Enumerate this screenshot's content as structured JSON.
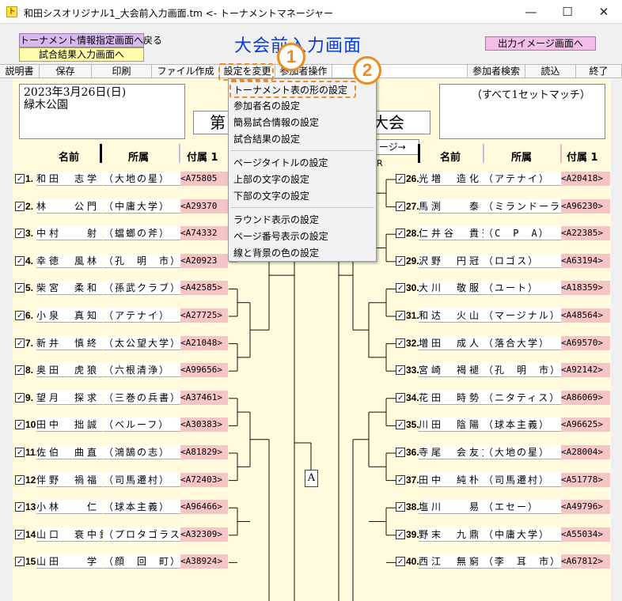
{
  "window": {
    "title": "和田シスオリジナル1_大会前入力画面.tm <- トーナメントマネージャー",
    "icon_glyph": "ト",
    "minimize": "—",
    "maximize": "☐",
    "close": "✕"
  },
  "top_buttons": {
    "back": "トーナメント情報指定画面へ戻る",
    "result": "試合結果入力画面へ",
    "output": "出力イメージ画面へ"
  },
  "page_title": "大会前入力画面",
  "toolbar": {
    "manual": "説明書",
    "save": "保存",
    "print": "印刷",
    "file_create": "ファイル作成",
    "settings": "設定を変更",
    "player_ops": "参加者操作",
    "search": "参加者検索",
    "load": "読込",
    "exit": "終了"
  },
  "info": {
    "date_line1": "2023年3月26日(日)",
    "date_line2": "緑木公園",
    "match_note": "（すべて1セットマッチ）",
    "tname_head": "第",
    "tname_tail": "大会",
    "next_page": "ージ→",
    "r_label": "R",
    "block_label": "A"
  },
  "headers": {
    "name": "名前",
    "affiliation": "所属",
    "extra": "付属 1"
  },
  "menu": {
    "group1": [
      "トーナメント表の形の設定",
      "参加者名の設定",
      "簡易試合情報の設定",
      "試合結果の設定"
    ],
    "group2": [
      "ページタイトルの設定",
      "上部の文字の設定",
      "下部の文字の設定"
    ],
    "group3": [
      "ラウンド表示の設定",
      "ページ番号表示の設定",
      "線と背景の色の設定"
    ]
  },
  "callouts": {
    "one": "1",
    "two": "2"
  },
  "left_players": [
    {
      "num": "1.",
      "name": "和田　志学",
      "aff": "（大地の星）",
      "code": "<A75805"
    },
    {
      "num": "2.",
      "name": "林　　公門",
      "aff": "（中庸大学）",
      "code": "<A29370"
    },
    {
      "num": "3.",
      "name": "中村　　射",
      "aff": "（蟷螂の斧）",
      "code": "<A74332"
    },
    {
      "num": "4.",
      "name": "幸徳　風林",
      "aff": "（孔　明　市）",
      "code": "<A20923"
    },
    {
      "num": "5.",
      "name": "柴宮　柔和",
      "aff": "（孫武クラブ）",
      "code": "<A42585>"
    },
    {
      "num": "6.",
      "name": "小泉　真知",
      "aff": "（アテナイ）",
      "code": "<A27725>"
    },
    {
      "num": "7.",
      "name": "新井　慎終",
      "aff": "（太公望大学）",
      "code": "<A21048>"
    },
    {
      "num": "8.",
      "name": "奥田　虎狼",
      "aff": "（六根清浄）",
      "code": "<A99656>"
    },
    {
      "num": "9.",
      "name": "望月　探求",
      "aff": "（三巻の兵書）",
      "code": "<A37461>"
    },
    {
      "num": "10.",
      "name": "田中　拙誠",
      "aff": "（ベルーフ）",
      "code": "<A30383>"
    },
    {
      "num": "11.",
      "name": "佐伯　曲直",
      "aff": "（鴻鵠の志）",
      "code": "<A81829>"
    },
    {
      "num": "12.",
      "name": "伴野　禍福",
      "aff": "（司馬遷村）",
      "code": "<A72403>"
    },
    {
      "num": "13.",
      "name": "小林　　仁",
      "aff": "（球本主義）",
      "code": "<A96466>"
    },
    {
      "num": "14.",
      "name": "山口　衰中錐",
      "aff": "（プロタゴラス）",
      "code": "<A32309>"
    },
    {
      "num": "15.",
      "name": "山田　　学",
      "aff": "（顔　回　町）",
      "code": "<A38924>"
    }
  ],
  "right_players": [
    {
      "num": "26.",
      "name": "光増　造化",
      "aff": "（アテナイ）",
      "code": "<A20418>"
    },
    {
      "num": "27.",
      "name": "馬渕　　泰",
      "aff": "（ミランドーラ）",
      "code": "<A96230>"
    },
    {
      "num": "28.",
      "name": "仁井谷　貴賓",
      "aff": "（C　P　A）",
      "code": "<A22385>"
    },
    {
      "num": "29.",
      "name": "沢野　円冠",
      "aff": "（ロゴス）",
      "code": "<A63194>"
    },
    {
      "num": "30.",
      "name": "大川　敬服",
      "aff": "（ユート）",
      "code": "<A18359>"
    },
    {
      "num": "31.",
      "name": "和达　火山",
      "aff": "（マージナル）",
      "code": "<A48564>"
    },
    {
      "num": "32.",
      "name": "増田　成人",
      "aff": "（落合大学）",
      "code": "<A69570>"
    },
    {
      "num": "33.",
      "name": "宮崎　褐褪",
      "aff": "（孔　明　市）",
      "code": "<A92142>"
    },
    {
      "num": "34.",
      "name": "花田　時勢",
      "aff": "（ニタティス）",
      "code": "<A86069>"
    },
    {
      "num": "35.",
      "name": "川田　陰陽",
      "aff": "（球本主義）",
      "code": "<A96625>"
    },
    {
      "num": "36.",
      "name": "寺尾　会友文",
      "aff": "（大地の星）",
      "code": "<A28004>"
    },
    {
      "num": "37.",
      "name": "田中　純朴",
      "aff": "（司馬遷村）",
      "code": "<A51778>"
    },
    {
      "num": "38.",
      "name": "塩川　　易",
      "aff": "（エセー）",
      "code": "<A49796>"
    },
    {
      "num": "39.",
      "name": "野末　九鼎",
      "aff": "（中庸大学）",
      "code": "<A55034>"
    },
    {
      "num": "40.",
      "name": "西江　無窮",
      "aff": "（李　耳　市）",
      "code": "<A67812>"
    }
  ]
}
